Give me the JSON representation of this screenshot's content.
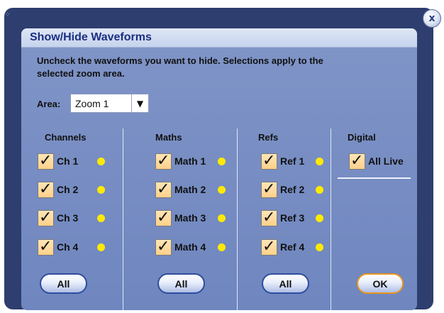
{
  "dialog": {
    "title": "Show/Hide Waveforms",
    "close_label": "x",
    "instructions": "Uncheck the waveforms you want to hide. Selections apply to the selected zoom area.",
    "area": {
      "label": "Area:",
      "value": "Zoom 1",
      "arrow": "▼"
    },
    "columns": {
      "channels": {
        "header": "Channels",
        "items": [
          {
            "label": "Ch 1",
            "checked": true
          },
          {
            "label": "Ch 2",
            "checked": true
          },
          {
            "label": "Ch 3",
            "checked": true
          },
          {
            "label": "Ch 4",
            "checked": true
          }
        ],
        "all_label": "All"
      },
      "maths": {
        "header": "Maths",
        "items": [
          {
            "label": "Math 1",
            "checked": true
          },
          {
            "label": "Math 2",
            "checked": true
          },
          {
            "label": "Math 3",
            "checked": true
          },
          {
            "label": "Math 4",
            "checked": true
          }
        ],
        "all_label": "All"
      },
      "refs": {
        "header": "Refs",
        "items": [
          {
            "label": "Ref 1",
            "checked": true
          },
          {
            "label": "Ref 2",
            "checked": true
          },
          {
            "label": "Ref 3",
            "checked": true
          },
          {
            "label": "Ref 4",
            "checked": true
          }
        ],
        "all_label": "All"
      },
      "digital": {
        "header": "Digital",
        "items": [
          {
            "label": "All Live",
            "checked": true
          }
        ]
      }
    },
    "ok_label": "OK",
    "check_glyph": "✓",
    "colors": {
      "frame": "#2d3e6f",
      "panel": "#7e93c6",
      "title_text": "#1b2f80",
      "indicator_dot": "#ffea00",
      "checkbox_fill": "#ffd18a",
      "ok_border": "#e8951e",
      "all_border": "#2f4d9f"
    },
    "icons": [
      "close-icon",
      "check-icon",
      "dropdown-arrow-icon",
      "resize-grip-icon",
      "waveform-dot-icon"
    ]
  }
}
